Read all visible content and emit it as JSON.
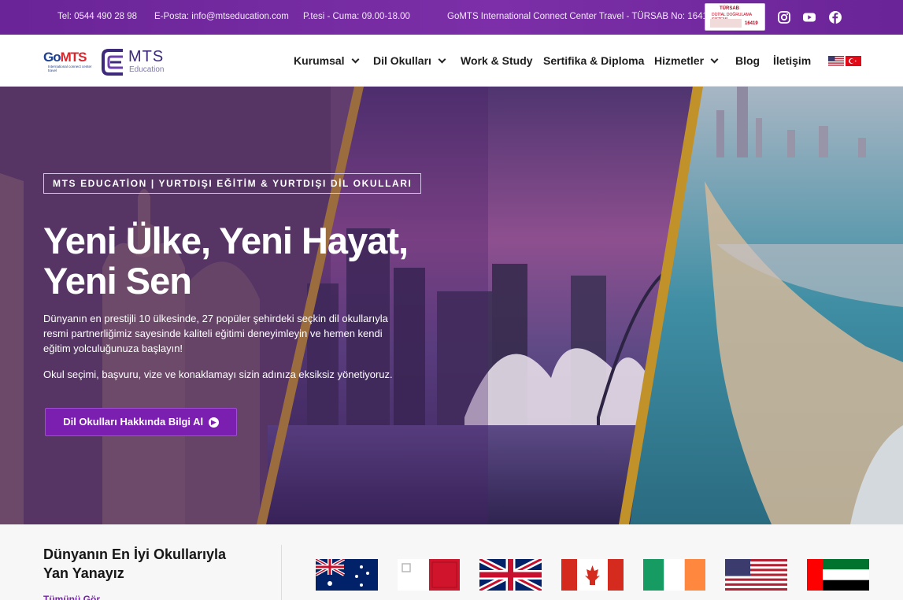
{
  "topbar": {
    "phone": "Tel: 0544 490 28 98",
    "email": "E-Posta: info@mtseducation.com",
    "hours": "P.tesi - Cuma: 09.00-18.00",
    "license": "GoMTS International Connect Center Travel - TÜRSAB No: 16419",
    "tursab_badge": {
      "title": "TÜRSAB",
      "line": "DİJİTAL DOĞRULAMA SİSTEMİ",
      "number": "16419"
    },
    "social_icons": [
      "instagram-icon",
      "youtube-icon",
      "facebook-icon"
    ]
  },
  "brand": {
    "gomts_logo": {
      "go": "Go",
      "mts": "MTS",
      "subtitle": "International connect center travel"
    },
    "mts_logo": {
      "name": "MTS",
      "tagline": "Education"
    }
  },
  "nav": {
    "items": [
      {
        "label": "Kurumsal",
        "dropdown": true
      },
      {
        "label": "Dil Okulları",
        "dropdown": true
      },
      {
        "label": "Work & Study",
        "dropdown": false
      },
      {
        "label": "Sertifika & Diploma",
        "dropdown": false
      },
      {
        "label": "Hizmetler",
        "dropdown": true
      },
      {
        "label": "Blog",
        "dropdown": false
      },
      {
        "label": "İletişim",
        "dropdown": false
      }
    ],
    "languages": [
      "english-flag-icon",
      "turkish-flag-icon"
    ]
  },
  "hero": {
    "tagline": "MTS EDUCATİON | YURTDIŞI EĞİTİM & YURTDIŞI DİL OKULLARI",
    "headline_line1": "Yeni Ülke, Yeni Hayat,",
    "headline_line2": "Yeni Sen",
    "lead": "Dünyanın en prestijli 10 ülkesinde, 27 popüler şehirdeki seçkin dil okullarıyla resmi partnerliğimiz sayesinde kaliteli eğitimi deneyimleyin ve hemen kendi eğitim yolculuğunuza başlayın!",
    "lead2": "Okul seçimi, başvuru, vize ve konaklamayı sizin adınıza eksiksiz yönetiyoruz.",
    "cta_label": "Dil Okulları Hakkında Bilgi Al",
    "cta_icon": "arrow-circle-right-icon"
  },
  "partners": {
    "title_line1": "Dünyanın En İyi Okullarıyla",
    "title_line2": "Yan Yanayız",
    "see_all": "Tümünü Gör",
    "flags": [
      "australia",
      "malta",
      "united-kingdom",
      "canada",
      "ireland",
      "united-states",
      "united-arab-emirates"
    ]
  }
}
